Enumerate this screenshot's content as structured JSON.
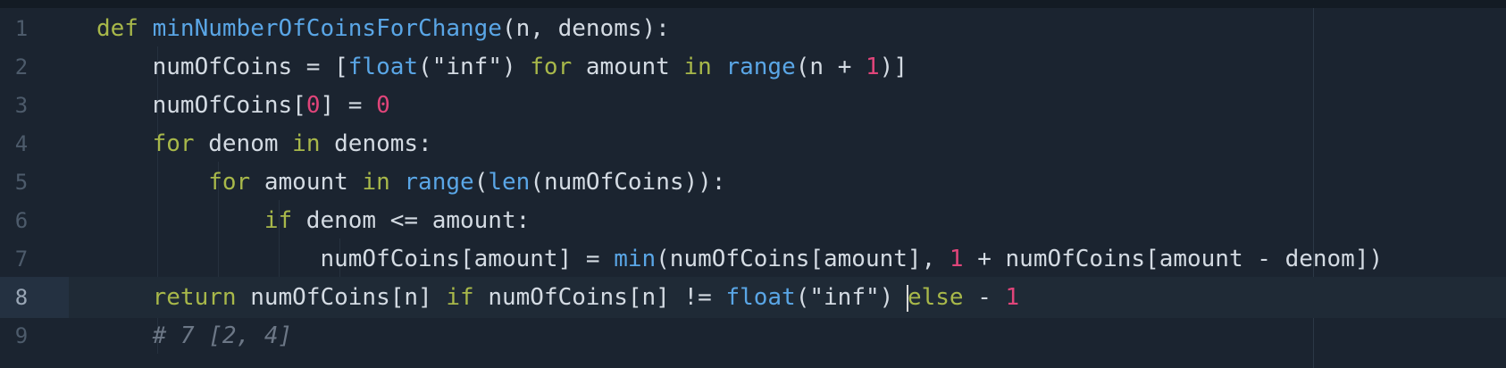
{
  "editor": {
    "language": "python",
    "active_line": 8,
    "lines": [
      {
        "number": "1",
        "tokens": [
          {
            "t": "def",
            "c": "kw"
          },
          {
            "t": " ",
            "c": ""
          },
          {
            "t": "minNumberOfCoinsForChange",
            "c": "fn"
          },
          {
            "t": "(n, denoms):",
            "c": ""
          }
        ]
      },
      {
        "number": "2",
        "tokens": [
          {
            "t": "    numOfCoins = [",
            "c": ""
          },
          {
            "t": "float",
            "c": "fn"
          },
          {
            "t": "(\"inf\") ",
            "c": ""
          },
          {
            "t": "for",
            "c": "kw"
          },
          {
            "t": " amount ",
            "c": ""
          },
          {
            "t": "in",
            "c": "kw"
          },
          {
            "t": " ",
            "c": ""
          },
          {
            "t": "range",
            "c": "fn"
          },
          {
            "t": "(n + ",
            "c": ""
          },
          {
            "t": "1",
            "c": "num"
          },
          {
            "t": ")]",
            "c": ""
          }
        ]
      },
      {
        "number": "3",
        "tokens": [
          {
            "t": "    numOfCoins[",
            "c": ""
          },
          {
            "t": "0",
            "c": "num"
          },
          {
            "t": "] = ",
            "c": ""
          },
          {
            "t": "0",
            "c": "num"
          }
        ]
      },
      {
        "number": "4",
        "tokens": [
          {
            "t": "    ",
            "c": ""
          },
          {
            "t": "for",
            "c": "kw"
          },
          {
            "t": " denom ",
            "c": ""
          },
          {
            "t": "in",
            "c": "kw"
          },
          {
            "t": " denoms:",
            "c": ""
          }
        ]
      },
      {
        "number": "5",
        "tokens": [
          {
            "t": "        ",
            "c": ""
          },
          {
            "t": "for",
            "c": "kw"
          },
          {
            "t": " amount ",
            "c": ""
          },
          {
            "t": "in",
            "c": "kw"
          },
          {
            "t": " ",
            "c": ""
          },
          {
            "t": "range",
            "c": "fn"
          },
          {
            "t": "(",
            "c": ""
          },
          {
            "t": "len",
            "c": "fn"
          },
          {
            "t": "(numOfCoins)):",
            "c": ""
          }
        ]
      },
      {
        "number": "6",
        "tokens": [
          {
            "t": "            ",
            "c": ""
          },
          {
            "t": "if",
            "c": "kw"
          },
          {
            "t": " denom <= amount:",
            "c": ""
          }
        ]
      },
      {
        "number": "7",
        "tokens": [
          {
            "t": "                numOfCoins[amount] = ",
            "c": ""
          },
          {
            "t": "min",
            "c": "fn"
          },
          {
            "t": "(numOfCoins[amount], ",
            "c": ""
          },
          {
            "t": "1",
            "c": "num"
          },
          {
            "t": " + numOfCoins[amount - denom])",
            "c": ""
          }
        ]
      },
      {
        "number": "8",
        "tokens": [
          {
            "t": "    ",
            "c": ""
          },
          {
            "t": "return",
            "c": "kw"
          },
          {
            "t": " numOfCoins[n] ",
            "c": ""
          },
          {
            "t": "if",
            "c": "kw"
          },
          {
            "t": " numOfCoins[n] != ",
            "c": ""
          },
          {
            "t": "float",
            "c": "fn"
          },
          {
            "t": "(\"inf\") ",
            "c": ""
          },
          {
            "t": "CURSOR",
            "c": "cursor"
          },
          {
            "t": "else",
            "c": "kw"
          },
          {
            "t": " - ",
            "c": ""
          },
          {
            "t": "1",
            "c": "num"
          }
        ]
      },
      {
        "number": "9",
        "tokens": [
          {
            "t": "    ",
            "c": ""
          },
          {
            "t": "# 7 [2, 4]",
            "c": "cmt"
          }
        ]
      }
    ]
  },
  "colors": {
    "background": "#1b2430",
    "keyword": "#a8b84a",
    "function": "#5aa6e6",
    "number": "#e0457a",
    "comment": "#6c7786",
    "line_number": "#4d5b6b"
  }
}
